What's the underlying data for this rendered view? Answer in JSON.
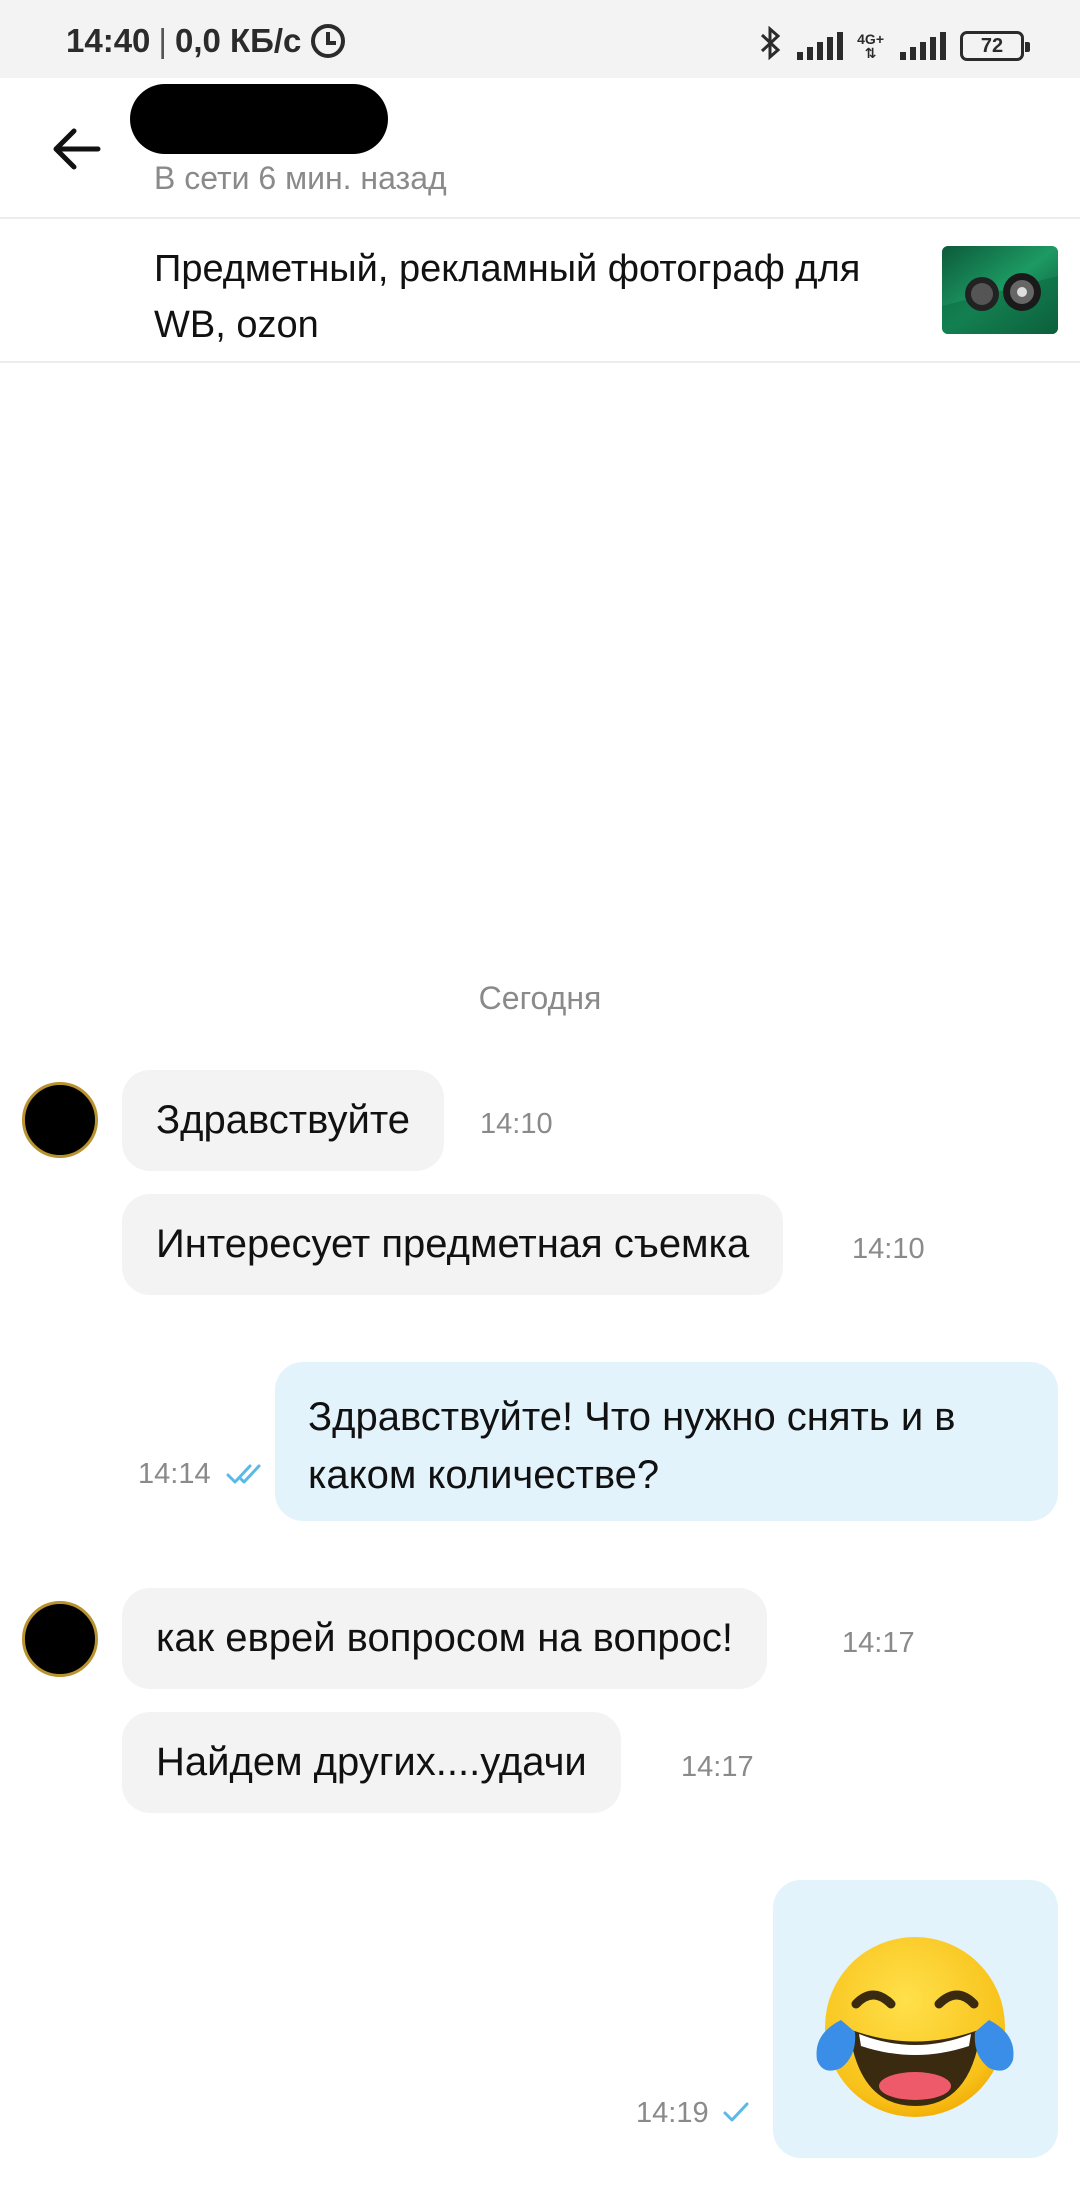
{
  "status_bar": {
    "time": "14:40",
    "speed": "0,0 КБ/с",
    "network": "4G+",
    "battery": "72",
    "icons": [
      "alarm-icon",
      "bluetooth-icon",
      "signal-icon",
      "battery-icon"
    ]
  },
  "header": {
    "back_icon": "arrow-left-icon",
    "status": "В сети 6 мин. назад"
  },
  "listing": {
    "title": "Предметный, рекламный фотограф для WB, ozon"
  },
  "chat": {
    "date_separator": "Сегодня",
    "messages": [
      {
        "direction": "in",
        "text": "Здравствуйте",
        "time": "14:10"
      },
      {
        "direction": "in",
        "text": "Интересует предметная съемка",
        "time": "14:10"
      },
      {
        "direction": "out",
        "text_line1": "Здравствуйте! Что нужно снять и в",
        "text_line2": "каком количестве?",
        "time": "14:14",
        "status": "read"
      },
      {
        "direction": "in",
        "text": "как еврей вопросом на вопрос!",
        "time": "14:17"
      },
      {
        "direction": "in",
        "text": "Найдем других....удачи",
        "time": "14:17"
      },
      {
        "direction": "out",
        "emoji": "face-with-tears-of-joy",
        "time": "14:19",
        "status": "sent"
      }
    ]
  },
  "colors": {
    "incoming_bubble": "#f3f3f3",
    "outgoing_bubble": "#e3f3fc",
    "tick": "#5ab9e6",
    "secondary_text": "#8a8a8a"
  }
}
